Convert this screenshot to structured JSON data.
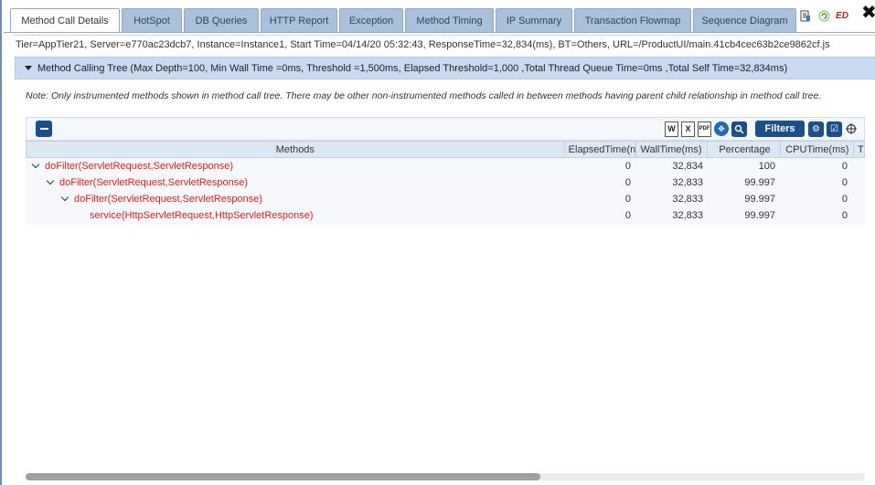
{
  "tabs": [
    {
      "label": "Method Call Details",
      "active": true
    },
    {
      "label": "HotSpot",
      "active": false
    },
    {
      "label": "DB Queries",
      "active": false
    },
    {
      "label": "HTTP Report",
      "active": false
    },
    {
      "label": "Exception",
      "active": false
    },
    {
      "label": "Method Timing",
      "active": false
    },
    {
      "label": "IP Summary",
      "active": false
    },
    {
      "label": "Transaction Flowmap",
      "active": false
    },
    {
      "label": "Sequence Diagram",
      "active": false
    }
  ],
  "top_icons": {
    "ed_label": "ED",
    "close_glyph": "✖"
  },
  "info_line": "Tier=AppTier21, Server=e770ac23dcb7, Instance=Instance1, Start Time=04/14/20 05:32:43, ResponseTime=32,834(ms), BT=Others, URL=/ProductUI/main.41cb4cec63b2ce9862cf.js",
  "panel": {
    "title": "Method Calling Tree (Max Depth=100, Min Wall Time =0ms, Threshold =1,500ms, Elapsed Threshold=1,000 ,Total Thread Queue Time=0ms ,Total Self Time=32,834ms)",
    "note": "Note: Only instrumented methods shown in method call tree. There may be other non-instrumented methods called in between methods having parent child relationship in method call tree."
  },
  "toolbar": {
    "filters_label": "Filters",
    "export_icons": [
      "W",
      "X",
      "PDF"
    ]
  },
  "table": {
    "columns": [
      "Methods",
      "ElapsedTime(n",
      "WallTime(ms)",
      "Percentage",
      "CPUTime(ms)",
      "Th"
    ],
    "rows": [
      {
        "method": "doFilter(ServletRequest,ServletResponse)",
        "elapsed": "0",
        "wall": "32,834",
        "percentage": "100",
        "cpu": "0",
        "expandable": true,
        "depth": 0
      },
      {
        "method": "doFilter(ServletRequest,ServletResponse)",
        "elapsed": "0",
        "wall": "32,833",
        "percentage": "99.997",
        "cpu": "0",
        "expandable": true,
        "depth": 1
      },
      {
        "method": "doFilter(ServletRequest,ServletResponse)",
        "elapsed": "0",
        "wall": "32,833",
        "percentage": "99.997",
        "cpu": "0",
        "expandable": true,
        "depth": 2
      },
      {
        "method": "service(HttpServletRequest,HttpServletResponse)",
        "elapsed": "0",
        "wall": "32,833",
        "percentage": "99.997",
        "cpu": "0",
        "expandable": false,
        "depth": 3
      }
    ]
  },
  "colors": {
    "method_text": "#e31b1b",
    "tab_bg": "#a9c1dc",
    "header_bg": "#c9daf0",
    "button_bg": "#1b4f8c"
  }
}
